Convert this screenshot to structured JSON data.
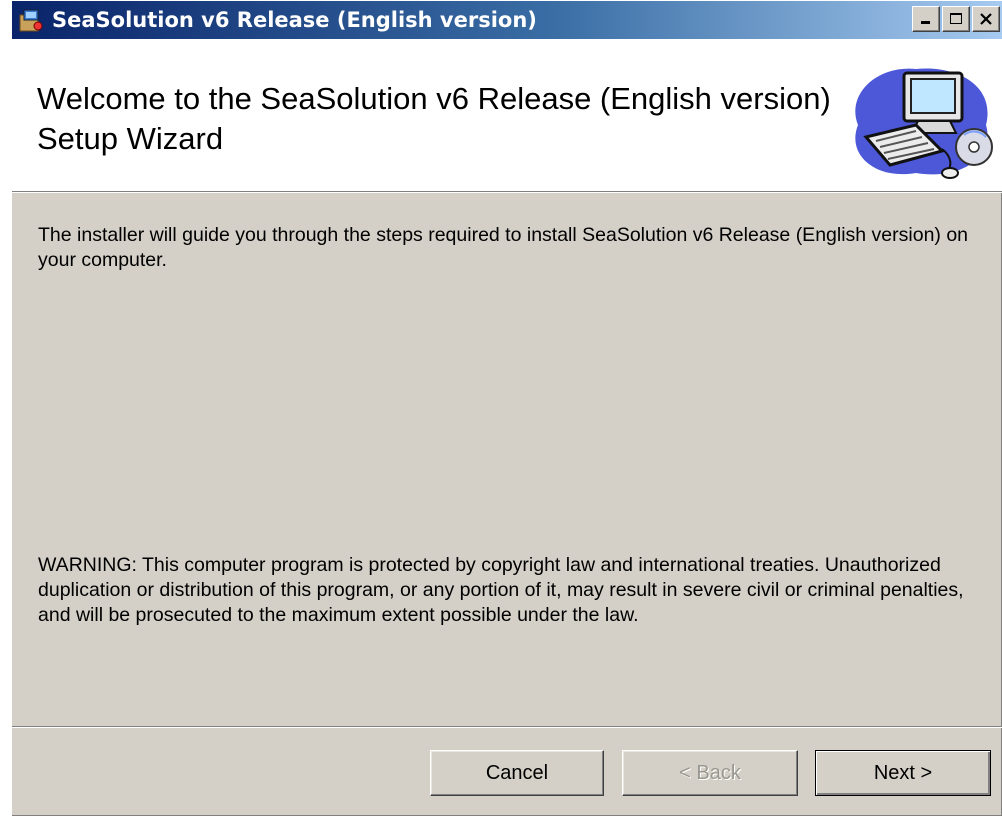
{
  "window": {
    "title": "SeaSolution v6 Release (English version)",
    "controls": {
      "minimize_icon": "minimize-icon",
      "maximize_icon": "maximize-icon",
      "close_icon": "close-icon"
    }
  },
  "header": {
    "title": "Welcome to the SeaSolution v6 Release (English version) Setup Wizard",
    "graphic_icon": "computer-cd-icon"
  },
  "content": {
    "intro": "The installer will guide you through the steps required to install SeaSolution v6 Release (English version) on your computer.",
    "warning": "WARNING: This computer program is protected by copyright law and international treaties. Unauthorized duplication or distribution of this program, or any portion of it, may result in severe civil or criminal penalties, and will be prosecuted to the maximum extent possible under the law."
  },
  "buttons": {
    "cancel": "Cancel",
    "back": "< Back",
    "next": "Next >"
  },
  "colors": {
    "title_bar_start": "#0a246a",
    "title_bar_end": "#a6caf0",
    "dialog_face": "#d4d0c8",
    "header_bg": "#ffffff"
  }
}
